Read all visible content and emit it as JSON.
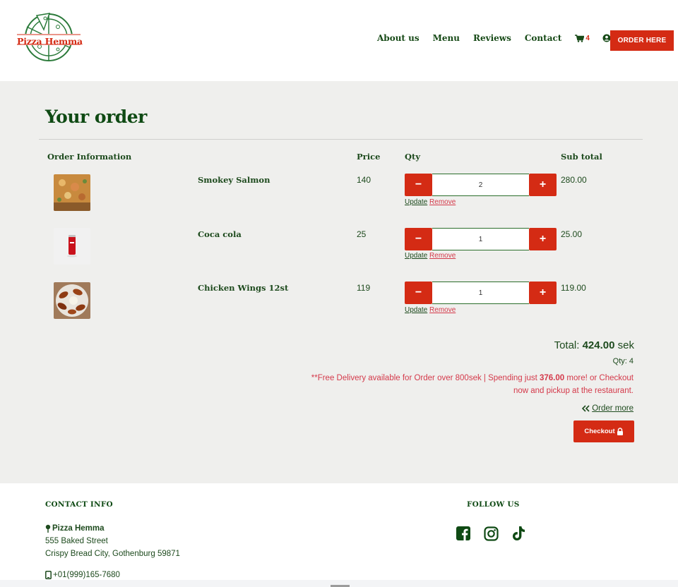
{
  "header": {
    "logo_text": "Pizza Hemma",
    "nav": [
      "About us",
      "Menu",
      "Reviews",
      "Contact"
    ],
    "cart_count": "4",
    "order_button": "ORDER HERE"
  },
  "main": {
    "title": "Your order",
    "columns": {
      "info": "Order Information",
      "price": "Price",
      "qty": "Qty",
      "subtotal": "Sub total"
    },
    "items": [
      {
        "name": "Smokey Salmon",
        "price": "140",
        "qty": "2",
        "subtotal": "280.00",
        "minus": "−",
        "plus": "+",
        "update": "Update",
        "remove": "Remove"
      },
      {
        "name": "Coca cola",
        "price": "25",
        "qty": "1",
        "subtotal": "25.00",
        "minus": "−",
        "plus": "+",
        "update": "Update",
        "remove": "Remove"
      },
      {
        "name": "Chicken Wings 12st",
        "price": "119",
        "qty": "1",
        "subtotal": "119.00",
        "minus": "−",
        "plus": "+",
        "update": "Update",
        "remove": "Remove"
      }
    ],
    "total_label": "Total:",
    "total_value": "424.00",
    "total_unit": "sek",
    "qty_total": "Qty: 4",
    "notice_part1": "**Free Delivery available for Order over 800sek | Spending just",
    "notice_amount": "376.00",
    "notice_part2": "more! or Checkout now and pickup at the restaurant.",
    "order_more": "Order more",
    "checkout": "Checkout"
  },
  "footer": {
    "contact_heading": "CONTACT INFO",
    "name": "Pizza Hemma",
    "street": "555 Baked Street",
    "city": "Crispy Bread City, Gothenburg 59871",
    "phone": "+01(999)165-7680",
    "follow_heading": "FOLLOW US"
  },
  "colors": {
    "brand_green": "#174a17",
    "brand_red": "#d42b14",
    "notice_red": "#d4394a",
    "main_bg": "#efefed"
  }
}
